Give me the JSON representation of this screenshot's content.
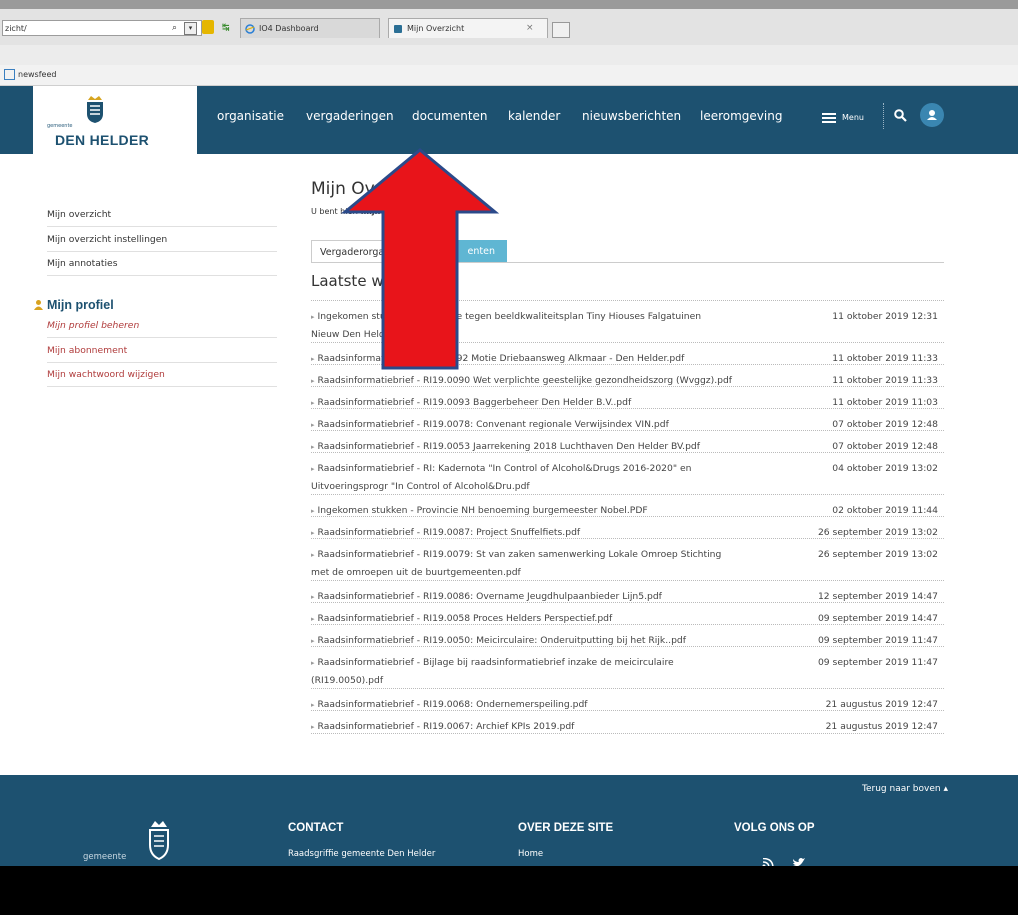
{
  "browser": {
    "address": "zicht/",
    "tabs": [
      {
        "label": "IO4 Dashboard"
      },
      {
        "label": "Mijn Overzicht"
      }
    ],
    "tab_close": "×",
    "favorites_item": "newsfeed"
  },
  "header": {
    "logo_small": "gemeente",
    "logo_name": "DEN HELDER",
    "nav": [
      "organisatie",
      "vergaderingen",
      "documenten",
      "kalender",
      "nieuwsberichten",
      "leeromgeving"
    ],
    "menu_label": "Menu"
  },
  "sidebar": {
    "items": [
      "Mijn overzicht",
      "Mijn overzicht instellingen",
      "Mijn annotaties"
    ],
    "profile_title": "Mijn profiel",
    "profile_items": [
      "Mijn profiel beheren",
      "Mijn abonnement",
      "Mijn wachtwoord wijzigen"
    ]
  },
  "main": {
    "title": "Mijn Overzi",
    "breadcrumb_prefix": "U bent hier: ",
    "breadcrumb_current": "mijnoverz",
    "tabs": [
      "Vergaderorganen",
      "enten"
    ],
    "section_title": "Laatste wijzig",
    "rows": [
      {
        "title": "Ingekomen stukke",
        "title_rest": "ze tegen beeldkwaliteitsplan Tiny Hiouses Falgatuinen",
        "title2": "Nieuw Den Helder",
        "date": "11 oktober 2019 12:31"
      },
      {
        "title": "Raadsinformatiebrie",
        "title_rest": "92 Motie Driebaansweg Alkmaar - Den Helder.pdf",
        "date": "11 oktober 2019 11:33"
      },
      {
        "title": "Raadsinformatiebrief - RI19.0090 Wet verplichte geestelijke gezondheidszorg (Wvggz).pdf",
        "date": "11 oktober 2019 11:33"
      },
      {
        "title": "Raadsinformatiebrief - RI19.0093 Baggerbeheer Den Helder B.V..pdf",
        "date": "11 oktober 2019 11:03"
      },
      {
        "title": "Raadsinformatiebrief - RI19.0078: Convenant regionale Verwijsindex VIN.pdf",
        "date": "07 oktober 2019 12:48"
      },
      {
        "title": "Raadsinformatiebrief - RI19.0053 Jaarrekening 2018 Luchthaven Den Helder BV.pdf",
        "date": "07 oktober 2019 12:48"
      },
      {
        "title": "Raadsinformatiebrief - RI: Kadernota \"In Control of Alcohol&Drugs 2016-2020\" en",
        "title2": "Uitvoeringsprogr \"In Control of Alcohol&Dru.pdf",
        "date": "04 oktober 2019 13:02"
      },
      {
        "title": "Ingekomen stukken - Provincie NH benoeming burgemeester Nobel.PDF",
        "date": "02 oktober 2019 11:44"
      },
      {
        "title": "Raadsinformatiebrief - RI19.0087: Project Snuffelfiets.pdf",
        "date": "26 september 2019 13:02"
      },
      {
        "title": "Raadsinformatiebrief - RI19.0079: St van zaken samenwerking Lokale Omroep Stichting",
        "title2": "met de omroepen uit de buurtgemeenten.pdf",
        "date": "26 september 2019 13:02"
      },
      {
        "title": "Raadsinformatiebrief - RI19.0086: Overname Jeugdhulpaanbieder Lijn5.pdf",
        "date": "12 september 2019 14:47"
      },
      {
        "title": "Raadsinformatiebrief - RI19.0058 Proces Helders Perspectief.pdf",
        "date": "09 september 2019 14:47"
      },
      {
        "title": "Raadsinformatiebrief - RI19.0050: Meicirculaire: Onderuitputting bij het Rijk..pdf",
        "date": "09 september 2019 11:47"
      },
      {
        "title": "Raadsinformatiebrief - Bijlage bij raadsinformatiebrief inzake de meicirculaire",
        "title2": "(RI19.0050).pdf",
        "date": "09 september 2019 11:47"
      },
      {
        "title": "Raadsinformatiebrief - RI19.0068: Ondernemerspeiling.pdf",
        "date": "21 augustus 2019 12:47"
      },
      {
        "title": "Raadsinformatiebrief - RI19.0067: Archief KPIs 2019.pdf",
        "date": "21 augustus 2019 12:47"
      }
    ]
  },
  "footer": {
    "back_to_top": "Terug naar boven",
    "gemeente": "gemeente",
    "contact_title": "CONTACT",
    "contact_line": "Raadsgriffie gemeente Den Helder",
    "about_title": "OVER DEZE SITE",
    "about_line": "Home",
    "follow_title": "VOLG ONS OP"
  },
  "colors": {
    "brand": "#1d5170",
    "tab_active": "#5fb6d3",
    "annotation_arrow": "#e8141a"
  }
}
